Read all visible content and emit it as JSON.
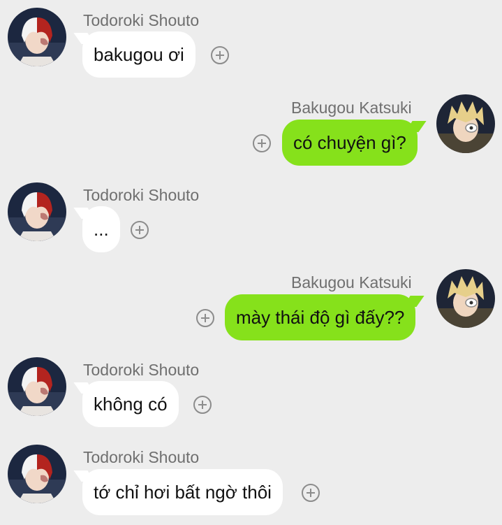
{
  "messages": [
    {
      "sender": "Todoroki Shouto",
      "text": "bakugou ơi",
      "side": "left",
      "avatar_icon": "todoroki-avatar-icon"
    },
    {
      "sender": "Bakugou Katsuki",
      "text": "có chuyện gì?",
      "side": "right",
      "avatar_icon": "bakugou-avatar-icon"
    },
    {
      "sender": "Todoroki Shouto",
      "text": "...",
      "side": "left",
      "avatar_icon": "todoroki-avatar-icon"
    },
    {
      "sender": "Bakugou Katsuki",
      "text": "mày thái độ gì đấy??",
      "side": "right",
      "avatar_icon": "bakugou-avatar-icon"
    },
    {
      "sender": "Todoroki Shouto",
      "text": "không có",
      "side": "left",
      "avatar_icon": "todoroki-avatar-icon"
    },
    {
      "sender": "Todoroki Shouto",
      "text": "tớ chỉ hơi bất ngờ thôi",
      "side": "left",
      "avatar_icon": "todoroki-avatar-icon"
    }
  ],
  "colors": {
    "background": "#ededed",
    "bubble_left": "#ffffff",
    "bubble_right": "#86e11b",
    "name_text": "#6f6f6f",
    "add_icon": "#8c8c8c"
  }
}
